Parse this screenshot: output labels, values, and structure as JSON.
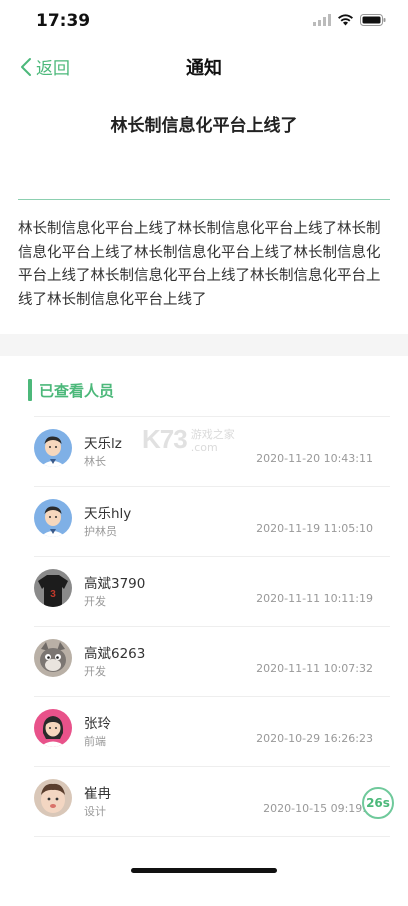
{
  "status_bar": {
    "time": "17:39",
    "icons": [
      "cellular-signal-icon",
      "wifi-icon",
      "battery-icon"
    ]
  },
  "nav": {
    "back_label": "返回",
    "title": "通知"
  },
  "notice": {
    "title": "林长制信息化平台上线了",
    "body": "林长制信息化平台上线了林长制信息化平台上线了林长制信息化平台上线了林长制信息化平台上线了林长制信息化平台上线了林长制信息化平台上线了林长制信息化平台上线了林长制信息化平台上线了"
  },
  "viewers": {
    "section_label": "已查看人员",
    "items": [
      {
        "name": "天乐lz",
        "role": "林长",
        "time": "2020-11-20 10:43:11",
        "avatar": "male-cartoon-avatar"
      },
      {
        "name": "天乐hly",
        "role": "护林员",
        "time": "2020-11-19 11:05:10",
        "avatar": "male-cartoon-avatar"
      },
      {
        "name": "高斌3790",
        "role": "开发",
        "time": "2020-11-11 10:11:19",
        "avatar": "jersey-photo-avatar"
      },
      {
        "name": "高斌6263",
        "role": "开发",
        "time": "2020-11-11 10:07:32",
        "avatar": "cartoon-cat-avatar"
      },
      {
        "name": "张玲",
        "role": "前端",
        "time": "2020-10-29 16:26:23",
        "avatar": "female-cartoon-avatar"
      },
      {
        "name": "崔冉",
        "role": "设计",
        "time": "2020-10-15 09:19:3",
        "avatar": "child-photo-avatar"
      }
    ]
  },
  "watermark": {
    "logo": "K73",
    "line1": "游戏之家",
    "line2": ".com"
  },
  "timer_badge": "26s",
  "colors": {
    "accent": "#4cb87a",
    "divider": "#8ccfb0",
    "gap_background": "#f5f5f5"
  }
}
